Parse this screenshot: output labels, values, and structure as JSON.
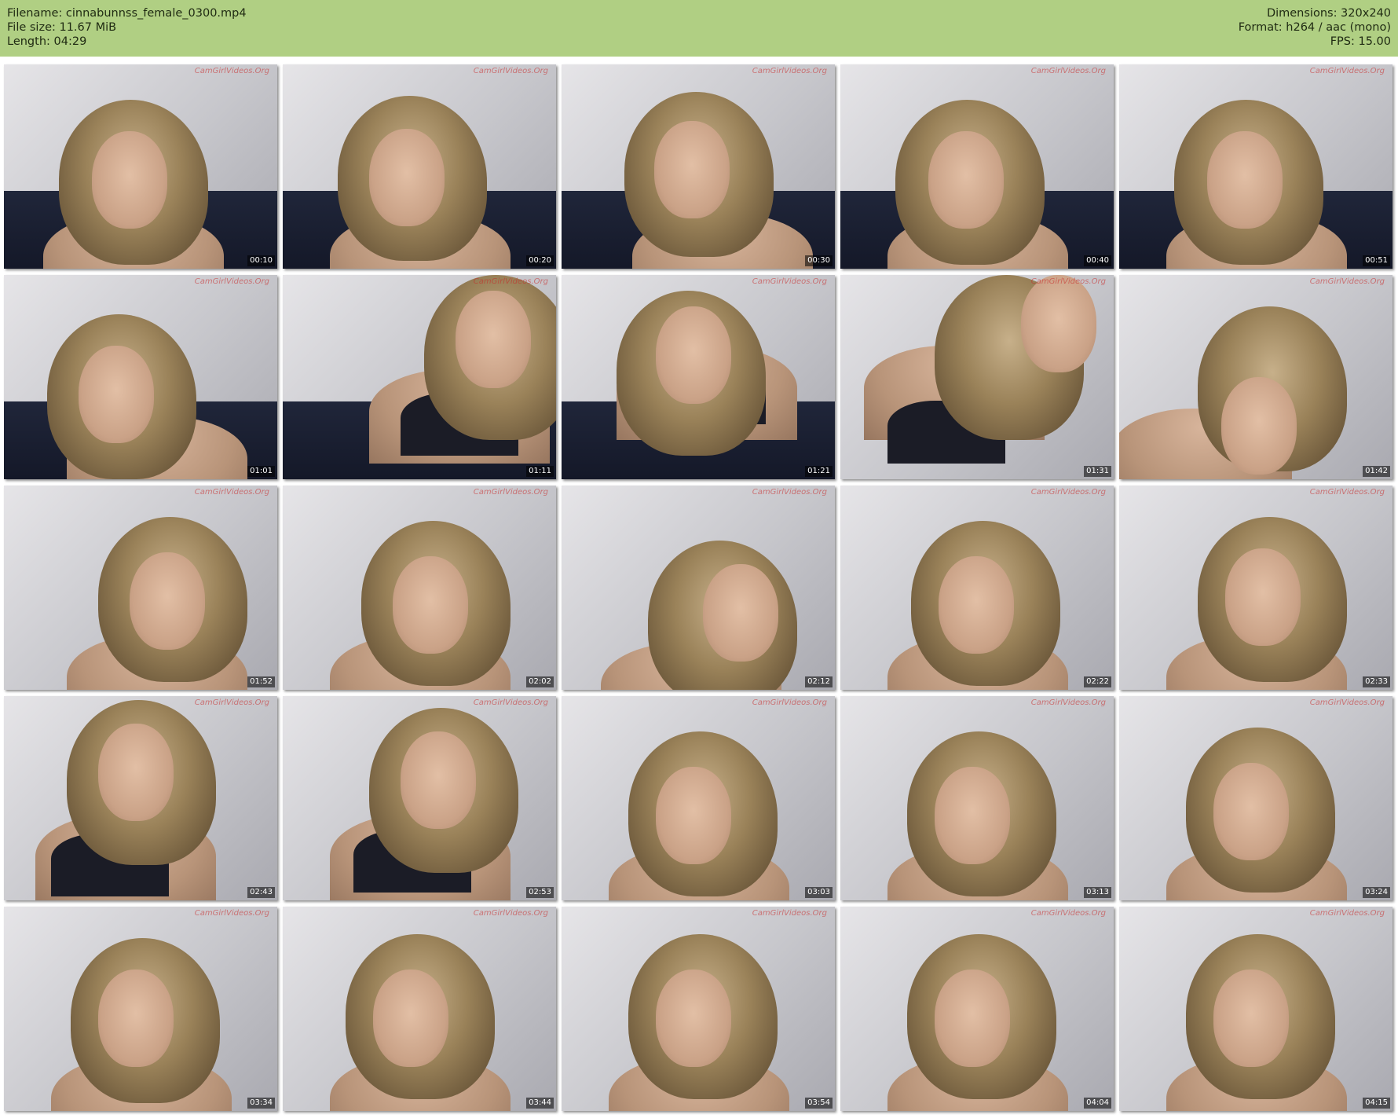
{
  "header": {
    "filename": "Filename: cinnabunnss_female_0300.mp4",
    "filesize": "File size: 11.67 MiB",
    "length": "Length: 04:29",
    "dimensions": "Dimensions: 320x240",
    "format": "Format: h264 / aac (mono)",
    "fps": "FPS: 15.00"
  },
  "thumbnails": [
    {
      "timestamp": "00:10",
      "watermark": "CamGirlVideos.Org"
    },
    {
      "timestamp": "00:20",
      "watermark": "CamGirlVideos.Org"
    },
    {
      "timestamp": "00:30",
      "watermark": "CamGirlVideos.Org"
    },
    {
      "timestamp": "00:40",
      "watermark": "CamGirlVideos.Org"
    },
    {
      "timestamp": "00:51",
      "watermark": "CamGirlVideos.Org"
    },
    {
      "timestamp": "01:01",
      "watermark": "CamGirlVideos.Org"
    },
    {
      "timestamp": "01:11",
      "watermark": "CamGirlVideos.Org"
    },
    {
      "timestamp": "01:21",
      "watermark": "CamGirlVideos.Org"
    },
    {
      "timestamp": "01:31",
      "watermark": "CamGirlVideos.Org"
    },
    {
      "timestamp": "01:42",
      "watermark": "CamGirlVideos.Org"
    },
    {
      "timestamp": "01:52",
      "watermark": "CamGirlVideos.Org"
    },
    {
      "timestamp": "02:02",
      "watermark": "CamGirlVideos.Org"
    },
    {
      "timestamp": "02:12",
      "watermark": "CamGirlVideos.Org"
    },
    {
      "timestamp": "02:22",
      "watermark": "CamGirlVideos.Org"
    },
    {
      "timestamp": "02:33",
      "watermark": "CamGirlVideos.Org"
    },
    {
      "timestamp": "02:43",
      "watermark": "CamGirlVideos.Org"
    },
    {
      "timestamp": "02:53",
      "watermark": "CamGirlVideos.Org"
    },
    {
      "timestamp": "03:03",
      "watermark": "CamGirlVideos.Org"
    },
    {
      "timestamp": "03:13",
      "watermark": "CamGirlVideos.Org"
    },
    {
      "timestamp": "03:24",
      "watermark": "CamGirlVideos.Org"
    },
    {
      "timestamp": "03:34",
      "watermark": "CamGirlVideos.Org"
    },
    {
      "timestamp": "03:44",
      "watermark": "CamGirlVideos.Org"
    },
    {
      "timestamp": "03:54",
      "watermark": "CamGirlVideos.Org"
    },
    {
      "timestamp": "04:04",
      "watermark": "CamGirlVideos.Org"
    },
    {
      "timestamp": "04:15",
      "watermark": "CamGirlVideos.Org"
    }
  ]
}
